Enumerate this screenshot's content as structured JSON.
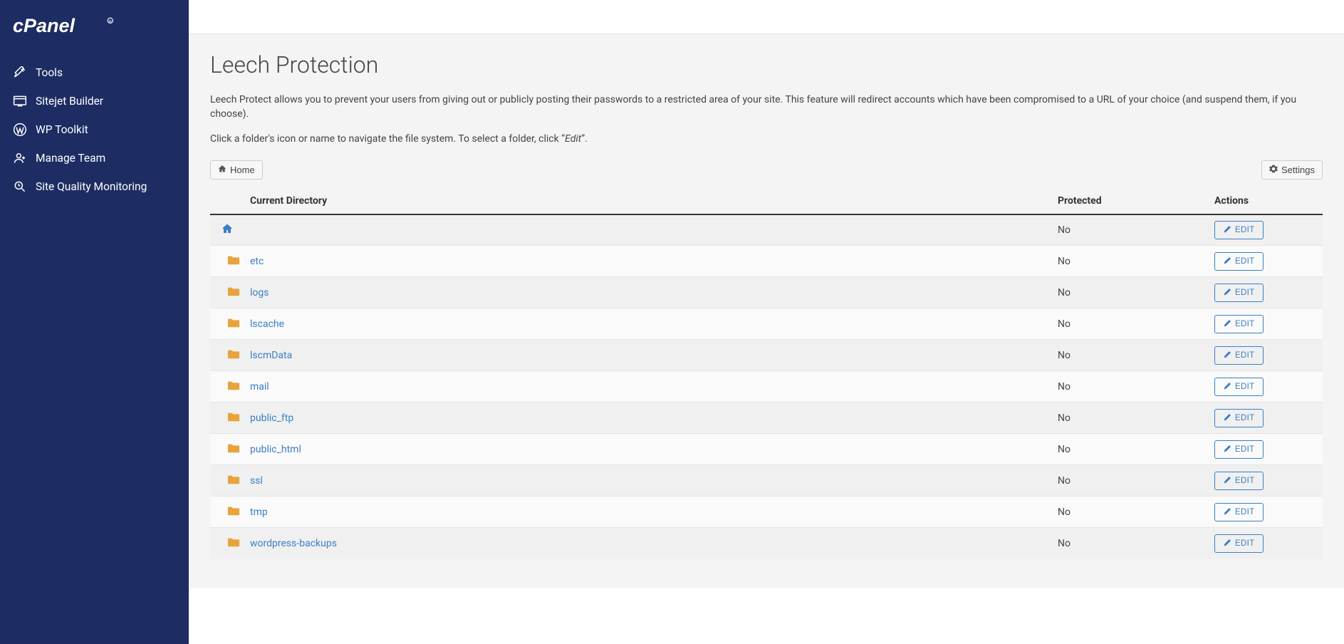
{
  "sidebar": {
    "items": [
      {
        "label": "Tools",
        "icon": "tools"
      },
      {
        "label": "Sitejet Builder",
        "icon": "sitejet"
      },
      {
        "label": "WP Toolkit",
        "icon": "wp"
      },
      {
        "label": "Manage Team",
        "icon": "team"
      },
      {
        "label": "Site Quality Monitoring",
        "icon": "magnify"
      }
    ]
  },
  "page": {
    "title": "Leech Protection",
    "desc1": "Leech Protect allows you to prevent your users from giving out or publicly posting their passwords to a restricted area of your site. This feature will redirect accounts which have been compromised to a URL of your choice (and suspend them, if you choose).",
    "desc2_a": "Click a folder's icon or name to navigate the file system. To select a folder, click “",
    "desc2_em": "Edit",
    "desc2_b": "”."
  },
  "toolbar": {
    "home_label": "Home",
    "settings_label": "Settings"
  },
  "table": {
    "headers": {
      "current_dir": "Current Directory",
      "protected": "Protected",
      "actions": "Actions"
    },
    "edit_label": "EDIT",
    "rows": [
      {
        "type": "home",
        "name": "",
        "protected": "No"
      },
      {
        "type": "folder",
        "name": "etc",
        "protected": "No"
      },
      {
        "type": "folder",
        "name": "logs",
        "protected": "No"
      },
      {
        "type": "folder",
        "name": "lscache",
        "protected": "No"
      },
      {
        "type": "folder",
        "name": "lscmData",
        "protected": "No"
      },
      {
        "type": "folder",
        "name": "mail",
        "protected": "No"
      },
      {
        "type": "folder",
        "name": "public_ftp",
        "protected": "No"
      },
      {
        "type": "folder",
        "name": "public_html",
        "protected": "No"
      },
      {
        "type": "folder",
        "name": "ssl",
        "protected": "No"
      },
      {
        "type": "folder",
        "name": "tmp",
        "protected": "No"
      },
      {
        "type": "folder",
        "name": "wordpress-backups",
        "protected": "No"
      }
    ]
  }
}
